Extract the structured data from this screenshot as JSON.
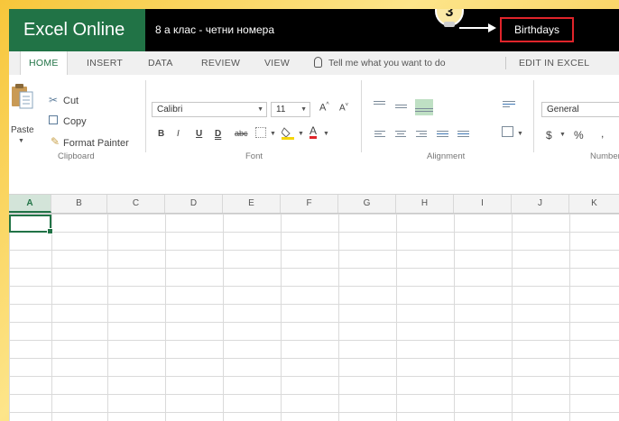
{
  "titlebar": {
    "app_name": "Excel Online",
    "document_title": "8 а клас - четни номера",
    "folder_name": "Birthdays",
    "annotation_number": "3"
  },
  "tabs": {
    "home": "HOME",
    "insert": "INSERT",
    "data": "DATA",
    "review": "REVIEW",
    "view": "VIEW",
    "tell_me": "Tell me what you want to do",
    "edit_in_excel": "EDIT IN EXCEL"
  },
  "ribbon": {
    "clipboard": {
      "paste": "Paste",
      "cut": "Cut",
      "copy": "Copy",
      "format_painter": "Format Painter",
      "label": "Clipboard"
    },
    "font": {
      "font_name": "Calibri",
      "font_size": "11",
      "bold": "B",
      "italic": "I",
      "underline": "U",
      "double_underline": "D",
      "strikethrough": "abc",
      "font_color": "A",
      "grow": "A",
      "shrink": "A",
      "label": "Font"
    },
    "alignment": {
      "label": "Alignment"
    },
    "number": {
      "format": "General",
      "currency": "$",
      "percent": "%",
      "label": "Number"
    }
  },
  "grid": {
    "columns": [
      "A",
      "B",
      "C",
      "D",
      "E",
      "F",
      "G",
      "H",
      "I",
      "J",
      "K"
    ],
    "selected_column": "A"
  },
  "colors": {
    "brand_green": "#217346",
    "highlight_red": "#e0242a",
    "titlebar_bg": "#000000"
  }
}
